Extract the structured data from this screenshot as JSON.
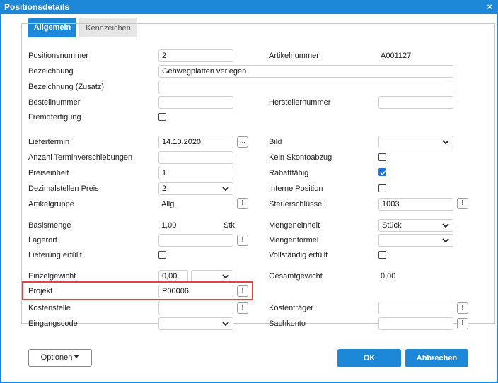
{
  "dialog": {
    "title": "Positionsdetails",
    "close_symbol": "×"
  },
  "tabs": [
    {
      "label": "Allgemein",
      "active": true
    },
    {
      "label": "Kennzeichen",
      "active": false
    }
  ],
  "fields": {
    "positionsnummer": {
      "label": "Positionsnummer",
      "value": "2"
    },
    "artikelnummer": {
      "label": "Artikelnummer",
      "value": "A001127"
    },
    "bezeichnung": {
      "label": "Bezeichnung",
      "value": "Gehwegplatten verlegen"
    },
    "bezeichnung_zusatz": {
      "label": "Bezeichnung (Zusatz)",
      "value": ""
    },
    "bestellnummer": {
      "label": "Bestellnummer",
      "value": ""
    },
    "herstellernummer": {
      "label": "Herstellernummer",
      "value": ""
    },
    "fremdfertigung": {
      "label": "Fremdfertigung",
      "checked": false
    },
    "liefertermin": {
      "label": "Liefertermin",
      "value": "14.10.2020",
      "button": "..."
    },
    "bild": {
      "label": "Bild",
      "value": ""
    },
    "anzahl_terminverschiebungen": {
      "label": "Anzahl Terminverschiebungen",
      "value": ""
    },
    "kein_skontoabzug": {
      "label": "Kein Skontoabzug",
      "checked": false
    },
    "preiseinheit": {
      "label": "Preiseinheit",
      "value": "1"
    },
    "rabattfaehig": {
      "label": "Rabattfähig",
      "checked": true
    },
    "dezimalstellen_preis": {
      "label": "Dezimalstellen Preis",
      "value": "2"
    },
    "interne_position": {
      "label": "Interne Position",
      "checked": false
    },
    "artikelgruppe": {
      "label": "Artikelgruppe",
      "value": "Allg."
    },
    "steuerschluessel": {
      "label": "Steuerschlüssel",
      "value": "1003"
    },
    "basismenge": {
      "label": "Basismenge",
      "value": "1,00",
      "unit": "Stk"
    },
    "mengeneinheit": {
      "label": "Mengeneinheit",
      "value": "Stück"
    },
    "lagerort": {
      "label": "Lagerort",
      "value": ""
    },
    "mengenformel": {
      "label": "Mengenformel",
      "value": ""
    },
    "lieferung_erfuellt": {
      "label": "Lieferung erfüllt",
      "checked": false
    },
    "vollstaendig_erfuellt": {
      "label": "Vollständig erfüllt",
      "checked": false
    },
    "einzelgewicht": {
      "label": "Einzelgewicht",
      "value": "0,00",
      "unit_value": ""
    },
    "gesamtgewicht": {
      "label": "Gesamtgewicht",
      "value": "0,00"
    },
    "projekt": {
      "label": "Projekt",
      "value": "P00006"
    },
    "kostenstelle": {
      "label": "Kostenstelle",
      "value": ""
    },
    "kostentraeger": {
      "label": "Kostenträger",
      "value": ""
    },
    "eingangscode": {
      "label": "Eingangscode",
      "value": ""
    },
    "sachkonto": {
      "label": "Sachkonto",
      "value": ""
    }
  },
  "info_button_symbol": "!",
  "footer": {
    "optionen": "Optionen",
    "ok": "OK",
    "abbrechen": "Abbrechen"
  },
  "colors": {
    "accent": "#1e88d8",
    "highlight": "#e04444",
    "checkbox_checked": "#1a73e8"
  }
}
